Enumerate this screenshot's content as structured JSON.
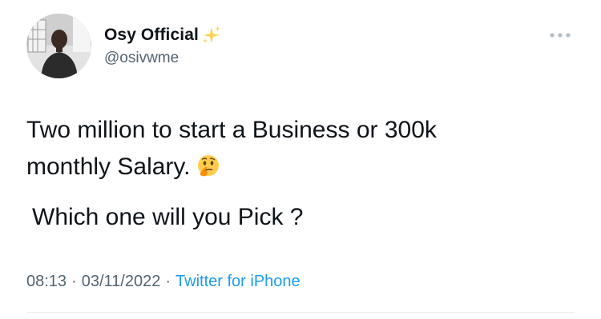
{
  "author": {
    "display_name": "Osy Official",
    "handle": "@osivwme",
    "name_emoji_icon": "sparkles-icon"
  },
  "tweet": {
    "text_line_1": "Two million to start a Business or 300k",
    "text_line_2": "monthly Salary.",
    "text_emoji_icon": "thinking-face-icon",
    "text_line_3": " Which one will you Pick ?",
    "time": "08:13",
    "separator": "·",
    "date": "03/11/2022",
    "source": "Twitter for iPhone"
  },
  "colors": {
    "text_primary": "#0f1419",
    "text_secondary": "#536471",
    "link": "#1d9bf0",
    "divider": "#e6e9eb"
  }
}
